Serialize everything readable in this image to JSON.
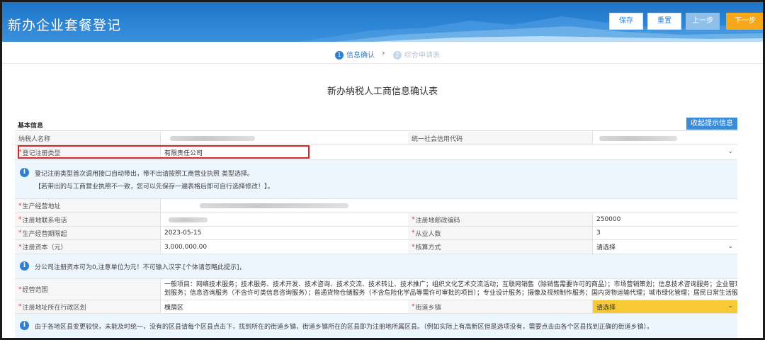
{
  "app": {
    "title": "新办企业套餐登记"
  },
  "toolbar": {
    "save": "保存",
    "reset": "重置",
    "prev": "上一步",
    "next": "下一步"
  },
  "steps": [
    {
      "num": "1",
      "label": "信息确认"
    },
    {
      "num": "2",
      "label": "综合申请表"
    }
  ],
  "step_sep": "›",
  "form": {
    "title": "新办纳税人工商信息确认表"
  },
  "section": {
    "label": "基本信息",
    "collapse": "收起提示信息"
  },
  "rows": {
    "taxpayer_name": "纳税人名称",
    "credit_code": "统一社会信用代码",
    "reg_type": "登记注册类型",
    "reg_type_value": "有限责任公司",
    "info1_line1": "登记注册类型首次调用接口自动带出，带不出请按照工商营业执照 类型选择。",
    "info1_line2": "【若带出的与工商营业执照不一致，您可以先保存一遍表格后即可自行选择修改！】。",
    "business_address": "生产经营地址",
    "reg_phone": "注册地联系电话",
    "reg_postcode": "注册地邮政编码",
    "reg_postcode_value": "250000",
    "biz_start": "生产经营期限起",
    "biz_start_value": "2023-05-15",
    "employees": "从业人数",
    "employees_value": "3",
    "reg_capital": "注册资本（元）",
    "reg_capital_value": "3,000,000.00",
    "accounting": "核算方式",
    "accounting_value": "请选择",
    "info2": "分公司注册资本可为0,注意单位为元！不可输入汉字.[个体请忽略此提示]，",
    "biz_scope": "经营范围",
    "biz_scope_line1": "一般项目：网络技术服务；技术服务、技术开发、技术咨询、技术交流、技术转让、技术推广；组织文化艺术交流活动；互联网销售（除销售需要许可的商品）；市场营销策划；信息技术咨询服务；企业管理咨询；咨询策",
    "biz_scope_line2": "划服务；信息咨询服务（不含许可类信息咨询服务）；普通货物仓储服务（不含危险化学品等需许可审批的项目）；专业设计服务；摄像及视频制作服务；国内货物运输代理；城市绿化管理；居民日常生活服务；供应链管",
    "district": "注册地址所在行政区划",
    "district_value": "槐荫区",
    "street": "街道乡镇",
    "street_value": "请选择",
    "info3": "由于各地区县变更较快，未能及时统一，没有的区县请每个区县点击下，找到所在的街道乡镇，街道乡镇所在的区县即为注册地所属区县。（例如实际上有高新区但是选项没有，需要点击由各个区县找到正确的街道乡镇）。"
  },
  "colors": {
    "header": "#2d86d6",
    "accent": "#2f7fd2",
    "next": "#f6a81a",
    "required": "#e03232",
    "highlight": "#d8262c",
    "select_yellow": "#f7c934"
  }
}
